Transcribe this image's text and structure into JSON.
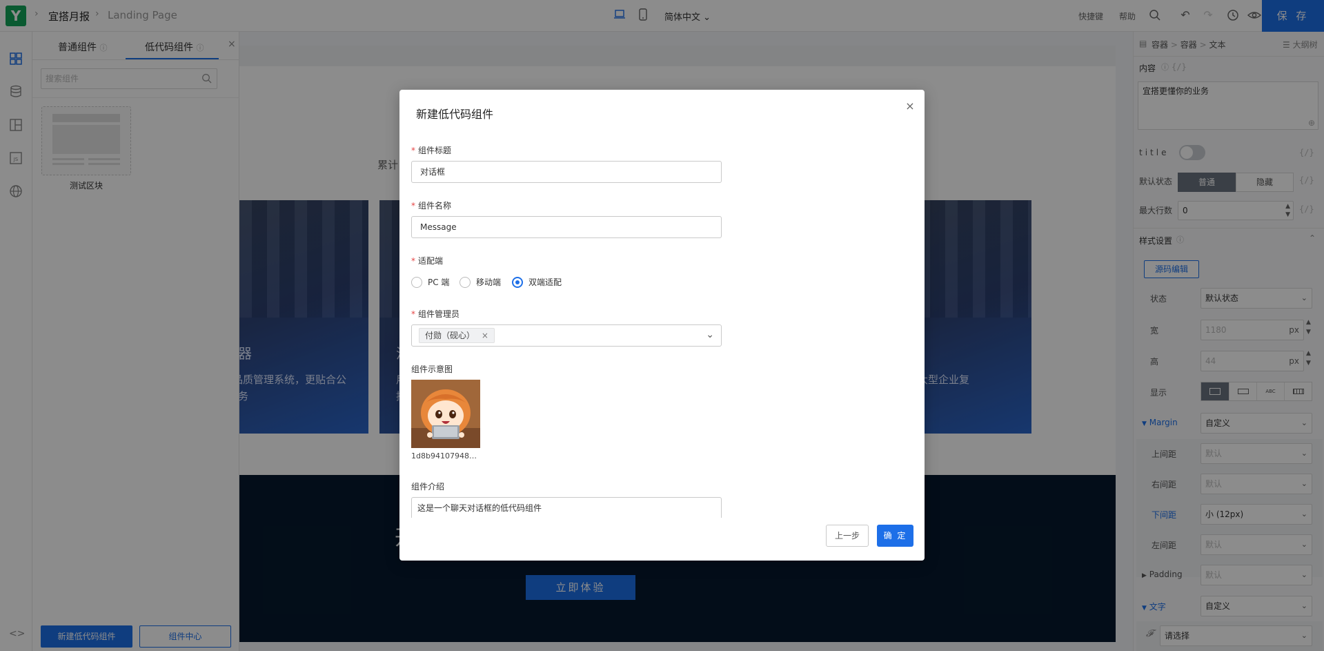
{
  "topbar": {
    "app_name": "宜搭月报",
    "page_name": "Landing Page",
    "language": "简体中文",
    "shortcut_label": "快捷键",
    "help_label": "帮助",
    "save_label": "保 存"
  },
  "left_panel": {
    "tabs": [
      {
        "label": "普通组件"
      },
      {
        "label": "低代码组件"
      }
    ],
    "search_placeholder": "搜索组件",
    "block_label": "测试区块",
    "new_button": "新建低代码组件",
    "center_button": "组件中心"
  },
  "canvas": {
    "partial_text": "累计",
    "caption_left_title": "器",
    "caption_left_text": "品质管理系统，更贴合公",
    "caption_left_text2": "务",
    "caption_mid_title": "流",
    "caption_mid_text": "用",
    "caption_mid_text2": "推",
    "caption_right_text": "大型企业复",
    "dark_title_partial": "开",
    "cta_label": "立即体验"
  },
  "right_panel": {
    "breadcrumb": [
      "容器",
      "容器",
      "文本"
    ],
    "outline_label": "大纲树",
    "content_label": "内容",
    "content_value": "宜搭更懂你的业务",
    "title_label": "title",
    "default_state_label": "默认状态",
    "state_options": [
      "普通",
      "隐藏"
    ],
    "max_rows_label": "最大行数",
    "max_rows_value": "0",
    "style_section": "样式设置",
    "source_edit": "源码编辑",
    "status_label": "状态",
    "status_value": "默认状态",
    "width_label": "宽",
    "width_value": "1180",
    "height_label": "高",
    "height_value": "44",
    "unit": "px",
    "display_label": "显示",
    "display_options": [
      "abc"
    ],
    "margin_label": "Margin",
    "margin_value": "自定义",
    "margin_top_label": "上间距",
    "margin_right_label": "右间距",
    "margin_bottom_label": "下间距",
    "margin_left_label": "左间距",
    "default_placeholder": "默认",
    "margin_bottom_value": "小 (12px)",
    "padding_label": "Padding",
    "padding_value": "默认",
    "text_label": "文字",
    "text_value": "自定义",
    "font_placeholder": "请选择",
    "braces": "{/}"
  },
  "modal": {
    "title": "新建低代码组件",
    "field_title_label": "组件标题",
    "field_title_value": "对话框",
    "field_name_label": "组件名称",
    "field_name_value": "Message",
    "adapt_label": "适配端",
    "adapt_options": [
      "PC 端",
      "移动端",
      "双端适配"
    ],
    "adapt_selected": 2,
    "admin_label": "组件管理员",
    "admin_tag": "付勋（砚心）",
    "preview_label": "组件示意图",
    "preview_filename": "1d8b94107948d...",
    "intro_label": "组件介绍",
    "intro_value": "这是一个聊天对话框的低代码组件",
    "prev_button": "上一步",
    "ok_button": "确 定"
  }
}
